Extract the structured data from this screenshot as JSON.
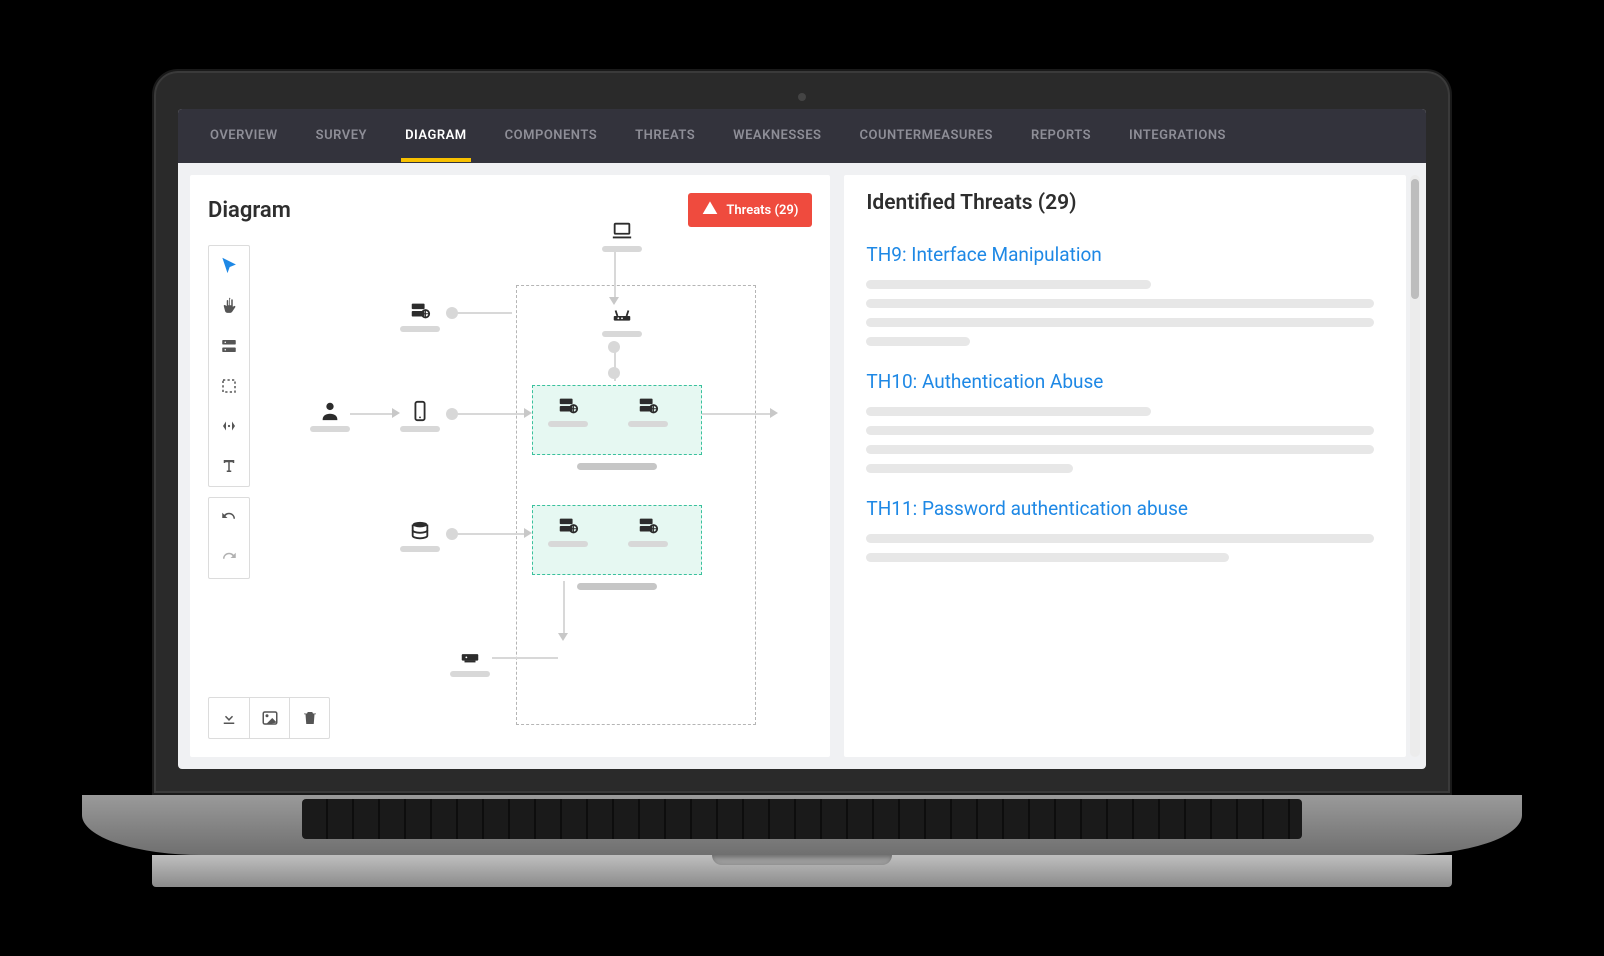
{
  "nav": {
    "tabs": [
      {
        "label": "OVERVIEW"
      },
      {
        "label": "SURVEY"
      },
      {
        "label": "DIAGRAM",
        "active": true
      },
      {
        "label": "COMPONENTS"
      },
      {
        "label": "THREATS"
      },
      {
        "label": "WEAKNESSES"
      },
      {
        "label": "COUNTERMEASURES"
      },
      {
        "label": "REPORTS"
      },
      {
        "label": "INTEGRATIONS"
      }
    ]
  },
  "left": {
    "title": "Diagram",
    "threats_button": "Threats (29)"
  },
  "toolbox": {
    "tools": [
      "pointer",
      "pan",
      "component",
      "marquee",
      "expand",
      "text"
    ],
    "history": [
      "undo",
      "redo"
    ],
    "actions": [
      "download",
      "image",
      "delete"
    ]
  },
  "right": {
    "title": "Identified Threats (29)",
    "items": [
      {
        "title": "TH9: Interface Manipulation"
      },
      {
        "title": "TH10: Authentication Abuse"
      },
      {
        "title": "TH11: Password authentication abuse"
      }
    ]
  }
}
